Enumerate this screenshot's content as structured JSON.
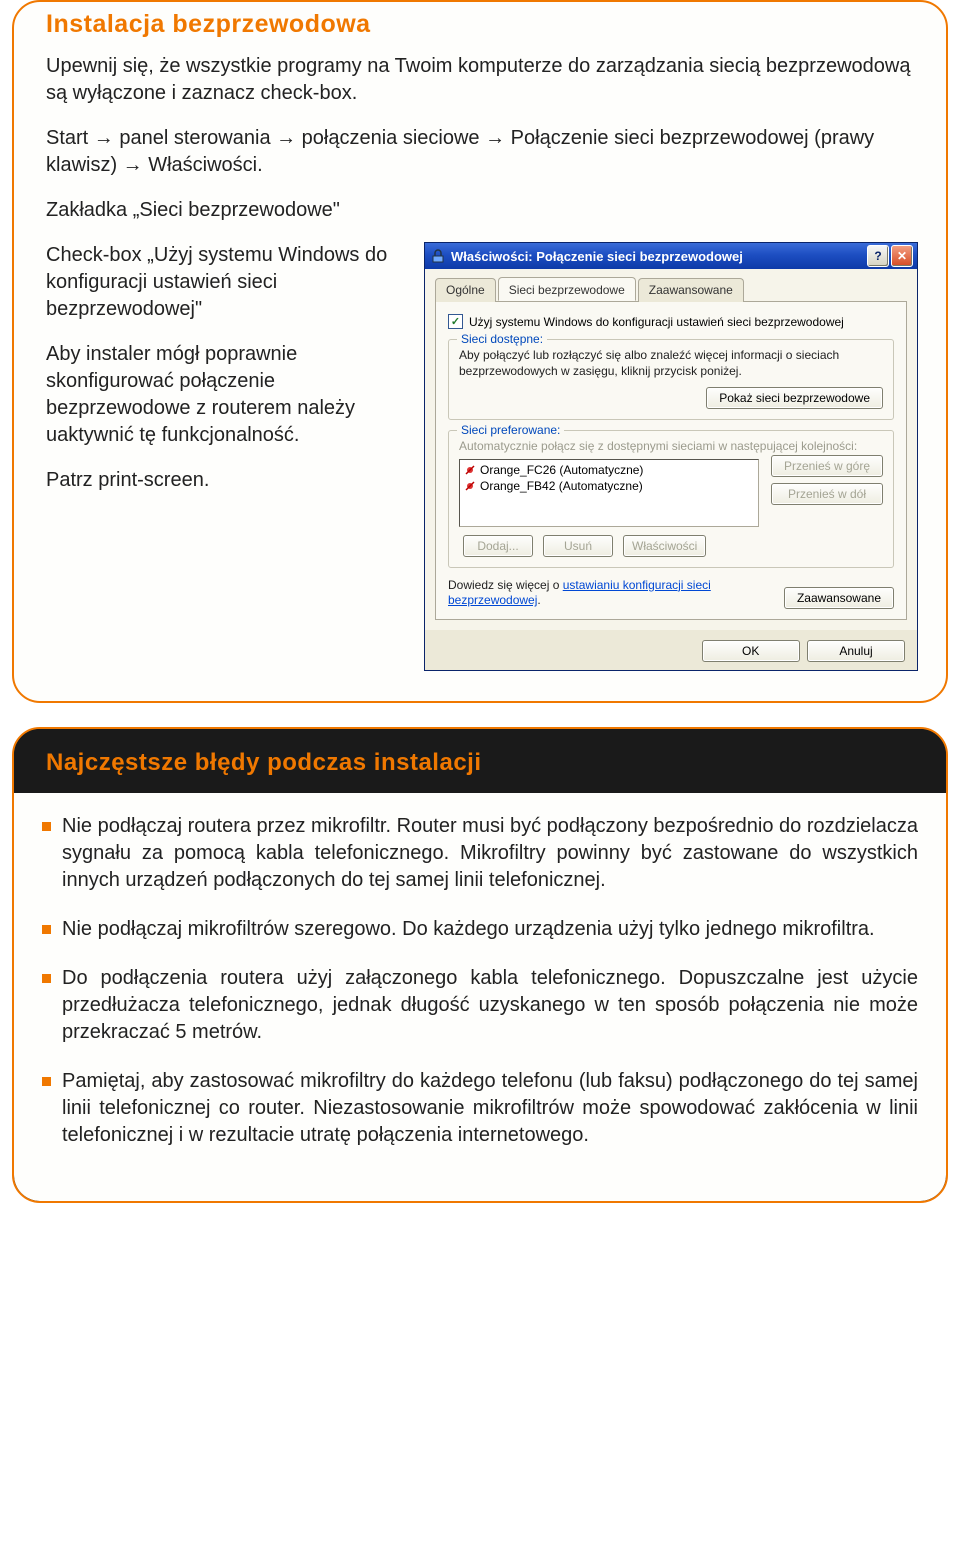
{
  "section1": {
    "title": "Instalacja bezprzewodowa",
    "p1": "Upewnij się, że wszystkie programy na Twoim komputerze do zarządzania siecią bezprzewodową są wyłączone i zaznacz check-box.",
    "p2": "Start → panel sterowania → połączenia sieciowe → Połączenie sieci bezprzewodowej (prawy klawisz) → Właściwości.",
    "p3": "Zakładka „Sieci bezprzewodowe\"",
    "left": {
      "para1a": "Check-box ",
      "para1b": "„Użyj systemu Windows do konfiguracji ustawień sieci bezprzewodowej\"",
      "para2": "Aby instaler mógł poprawnie skonfigurować połączenie bezprzewodowe z routerem należy uaktywnić tę funkcjonalność.",
      "para3": "Patrz print-screen."
    }
  },
  "win": {
    "title": "Właściwości: Połączenie sieci bezprzewodowej",
    "help": "?",
    "close": "✕",
    "tabs": {
      "general": "Ogólne",
      "wireless": "Sieci bezprzewodowe",
      "advanced": "Zaawansowane"
    },
    "checkbox_label": "Użyj systemu Windows do konfiguracji ustawień sieci bezprzewodowej",
    "available": {
      "legend": "Sieci dostępne:",
      "text": "Aby połączyć lub rozłączyć się albo znaleźć więcej informacji o sieciach bezprzewodowych w zasięgu, kliknij przycisk poniżej.",
      "button": "Pokaż sieci bezprzewodowe"
    },
    "preferred": {
      "legend": "Sieci preferowane:",
      "text": "Automatycznie połącz się z dostępnymi sieciami w następującej kolejności:",
      "items": [
        "Orange_FC26 (Automatyczne)",
        "Orange_FB42 (Automatyczne)"
      ],
      "up": "Przenieś w górę",
      "down": "Przenieś w dół",
      "add": "Dodaj...",
      "remove": "Usuń",
      "props": "Właściwości"
    },
    "learn_pre": "Dowiedz się więcej o ",
    "learn_link": "ustawianiu konfiguracji sieci bezprzewodowej",
    "learn_post": ".",
    "adv": "Zaawansowane",
    "ok": "OK",
    "cancel": "Anuluj"
  },
  "section2": {
    "title": "Najczęstsze błędy podczas instalacji",
    "bullets": [
      "Nie podłączaj routera przez mikrofiltr. Router musi być podłączony bezpośrednio do rozdzielacza sygnału za pomocą kabla telefonicznego. Mikrofiltry powinny być zastowane do wszystkich innych urządzeń podłączonych do tej samej linii telefonicznej.",
      "Nie podłączaj mikrofiltrów szeregowo. Do każdego urządzenia użyj tylko jednego mikrofiltra.",
      "Do podłączenia routera użyj załączonego kabla telefonicznego. Dopuszczalne jest użycie przedłużacza telefonicznego, jednak długość uzyskanego w ten sposób połączenia nie może przekraczać 5 metrów.",
      "Pamiętaj, aby zastosować mikrofiltry do każdego telefonu (lub faksu) podłączonego do tej samej linii telefonicznej co router. Niezastosowanie mikrofiltrów może spowodować zakłócenia w linii telefonicznej i w rezultacie utratę połączenia internetowego."
    ]
  }
}
